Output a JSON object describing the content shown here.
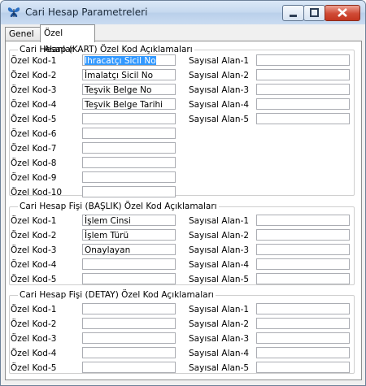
{
  "window": {
    "title": "Cari Hesap Parametreleri"
  },
  "tabs": [
    {
      "label": "Genel"
    },
    {
      "label": "Özel Alanlar"
    }
  ],
  "groups": {
    "kart": {
      "legend": "Cari Hesap (KART)  Özel Kod Açıklamaları",
      "kod_labels": [
        "Özel Kod-1",
        "Özel Kod-2",
        "Özel Kod-3",
        "Özel Kod-4",
        "Özel Kod-5",
        "Özel Kod-6",
        "Özel Kod-7",
        "Özel Kod-8",
        "Özel Kod-9",
        "Özel Kod-10"
      ],
      "kod_values": [
        "İhracatçı Sicil No",
        "İmalatçı Sicil No",
        "Teşvik Belge No",
        "Teşvik Belge Tarihi",
        "",
        "",
        "",
        "",
        "",
        ""
      ],
      "sayisal_labels": [
        "Sayısal Alan-1",
        "Sayısal Alan-2",
        "Sayısal Alan-3",
        "Sayısal Alan-4",
        "Sayısal Alan-5"
      ],
      "sayisal_values": [
        "",
        "",
        "",
        "",
        ""
      ]
    },
    "baslik": {
      "legend": "Cari Hesap Fişi  (BAŞLIK)  Özel Kod Açıklamaları",
      "kod_labels": [
        "Özel Kod-1",
        "Özel Kod-2",
        "Özel Kod-3",
        "Özel Kod-4",
        "Özel Kod-5"
      ],
      "kod_values": [
        "İşlem Cinsi",
        "İşlem Türü",
        "Onaylayan",
        "",
        ""
      ],
      "sayisal_labels": [
        "Sayısal Alan-1",
        "Sayısal Alan-2",
        "Sayısal Alan-3",
        "Sayısal Alan-4",
        "Sayısal Alan-5"
      ],
      "sayisal_values": [
        "",
        "",
        "",
        "",
        ""
      ]
    },
    "detay": {
      "legend": "Cari Hesap Fişi  (DETAY)  Özel Kod Açıklamaları",
      "kod_labels": [
        "Özel Kod-1",
        "Özel Kod-2",
        "Özel Kod-3",
        "Özel Kod-4",
        "Özel Kod-5"
      ],
      "kod_values": [
        "",
        "",
        "",
        "",
        ""
      ],
      "sayisal_labels": [
        "Sayısal Alan-1",
        "Sayısal Alan-2",
        "Sayısal Alan-3",
        "Sayısal Alan-4",
        "Sayısal Alan-5"
      ],
      "sayisal_values": [
        "",
        "",
        "",
        "",
        ""
      ]
    }
  },
  "colors": {
    "selection": "#3399ff",
    "close_button": "#c43620"
  }
}
